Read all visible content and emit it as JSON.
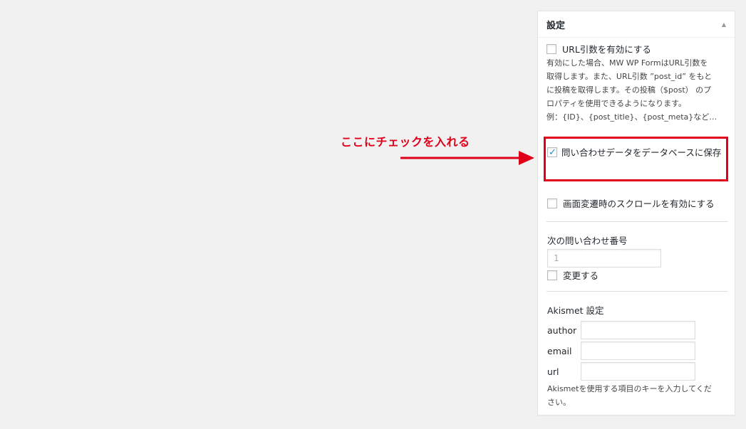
{
  "annotation": {
    "text": "ここにチェックを入れる",
    "color": "#e0001a"
  },
  "panel": {
    "title": "設定",
    "toggle_icon": "triangle-up-icon",
    "url_params": {
      "label": "URL引数を有効にする",
      "checked": false,
      "description_lines": [
        "有効にした場合、MW WP FormはURL引数を",
        "取得します。また、URL引数 ”post_id” をもと",
        "に投稿を取得します。その投稿（$post） のプ",
        "ロパティを使用できるようになります。",
        "例：{ID}、{post_title}、{post_meta}など…"
      ]
    },
    "save_db": {
      "label": "問い合わせデータをデータベースに保存",
      "checked": true
    },
    "scroll": {
      "label": "画面変遷時のスクロールを有効にする",
      "checked": false
    },
    "inquiry_number": {
      "heading": "次の問い合わせ番号",
      "value": "1",
      "change_label": "変更する",
      "change_checked": false
    },
    "akismet": {
      "heading": "Akismet 設定",
      "fields": [
        {
          "label": "author",
          "value": ""
        },
        {
          "label": "email",
          "value": ""
        },
        {
          "label": "url",
          "value": ""
        }
      ],
      "note_lines": [
        "Akismetを使用する項目のキーを入力してくだ",
        "さい。"
      ]
    }
  }
}
